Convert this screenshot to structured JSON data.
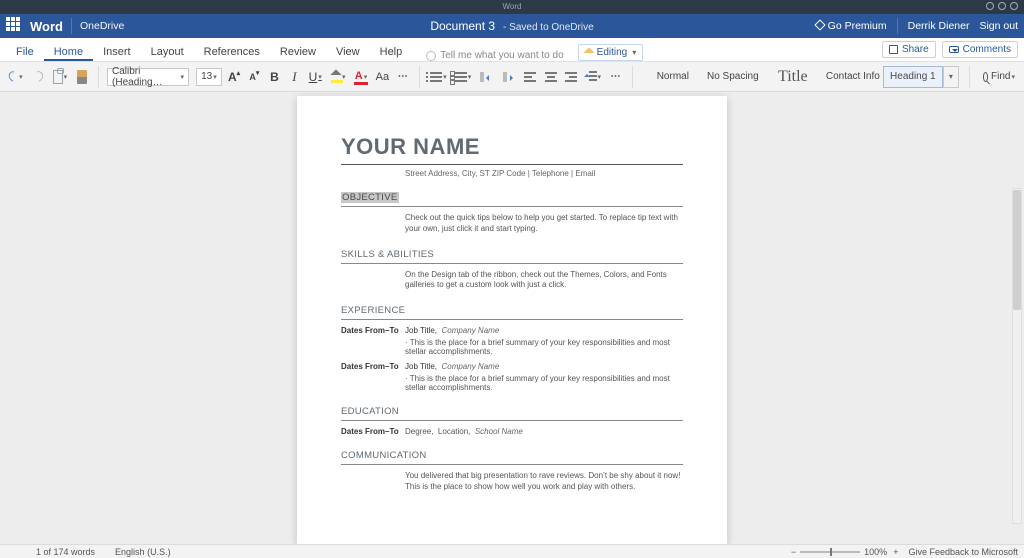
{
  "os": {
    "title": "Word"
  },
  "titlebar": {
    "brand": "Word",
    "onedrive": "OneDrive",
    "doc": "Document 3",
    "saved": "- Saved to OneDrive",
    "premium": "Go Premium",
    "user": "Derrik Diener",
    "signout": "Sign out"
  },
  "tabs": {
    "file": "File",
    "home": "Home",
    "insert": "Insert",
    "layout": "Layout",
    "references": "References",
    "review": "Review",
    "view": "View",
    "help": "Help",
    "tellme": "Tell me what you want to do",
    "editing": "Editing",
    "share": "Share",
    "comments": "Comments"
  },
  "ribbon": {
    "fontname": "Calibri (Heading…",
    "fontsize": "13",
    "styles": {
      "normal": "Normal",
      "nospacing": "No Spacing",
      "title": "Title",
      "contact": "Contact Info",
      "heading1": "Heading 1"
    },
    "find": "Find"
  },
  "doc": {
    "name": "YOUR NAME",
    "addr": "Street Address, City, ST ZIP Code | Telephone | Email",
    "objective": {
      "h": "OBJECTIVE",
      "p": "Check out the quick tips below to help you get started. To replace tip text with your own, just click it and start typing."
    },
    "skills": {
      "h": "SKILLS & ABILITIES",
      "p": "On the Design tab of the ribbon, check out the Themes, Colors, and Fonts galleries to get a custom look with just a click."
    },
    "exp": {
      "h": "EXPERIENCE",
      "rows": [
        {
          "l": "Dates From–To",
          "jt": "Job Title,",
          "cn": "Company Name",
          "d": "· This is the place for a brief summary of your key responsibilities and most stellar accomplishments."
        },
        {
          "l": "Dates From–To",
          "jt": "Job Title,",
          "cn": "Company Name",
          "d": "· This is the place for a brief summary of your key responsibilities and most stellar accomplishments."
        }
      ]
    },
    "edu": {
      "h": "EDUCATION",
      "rows": [
        {
          "l": "Dates From–To",
          "deg": "Degree,",
          "loc": "Location,",
          "sn": "School Name"
        }
      ]
    },
    "comm": {
      "h": "COMMUNICATION",
      "p": "You delivered that big presentation to rave reviews. Don’t be shy about it now! This is the place to show how well you work and play with others."
    }
  },
  "status": {
    "wc": "1 of 174 words",
    "lang": "English (U.S.)",
    "zminus": "−",
    "zoom": "100%",
    "zplus": "+",
    "feedback": "Give Feedback to Microsoft"
  }
}
